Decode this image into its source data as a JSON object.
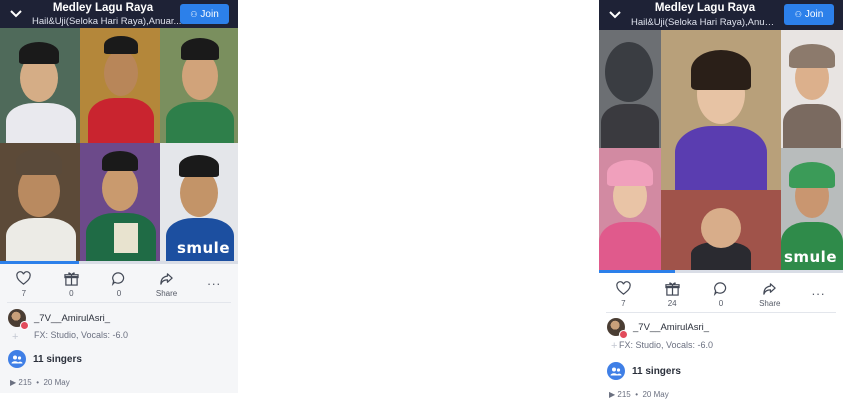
{
  "posts": [
    {
      "header": {
        "title": "Medley Lagu Raya",
        "subtitle": "Hail&Uji(Seloka Hari Raya),Anuar...",
        "join_label": "Join"
      },
      "video": {
        "brand": "smule",
        "progress": 0.33
      },
      "actions": {
        "likes": "7",
        "gifts": "0",
        "comments": "0",
        "share_label": "Share",
        "more_label": "..."
      },
      "user": {
        "name": "_7V__AmirulAsri_",
        "fx": "FX: Studio, Vocals: -6.0"
      },
      "singers_label": "11 singers",
      "plays": "215",
      "date": "20 May"
    },
    {
      "header": {
        "title": "Medley Lagu Raya",
        "subtitle": "Hail&Uji(Seloka Hari Raya),Anuar...",
        "join_label": "Join"
      },
      "video": {
        "brand": "smule",
        "progress": 0.31
      },
      "actions": {
        "likes": "7",
        "gifts": "24",
        "comments": "0",
        "share_label": "Share",
        "more_label": "..."
      },
      "user": {
        "name": "_7V__AmirulAsri_",
        "fx": "FX: Studio, Vocals: -6.0"
      },
      "singers_label": "11 singers",
      "plays": "215",
      "date": "20 May"
    }
  ]
}
